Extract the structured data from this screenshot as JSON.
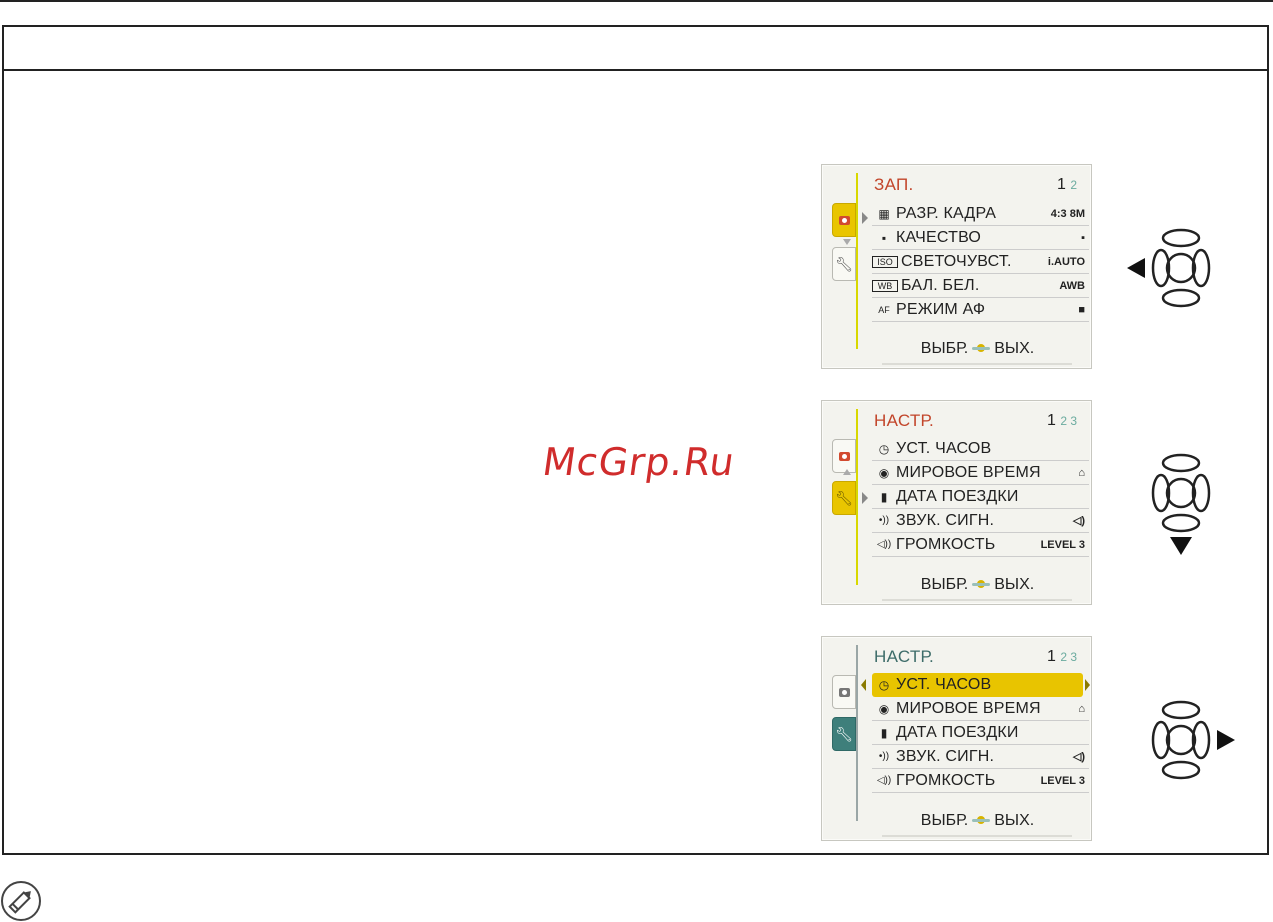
{
  "watermark": "McGrp.Ru",
  "screens": [
    {
      "title": "ЗАП.",
      "page_current": "1",
      "page_others": "2",
      "rows": [
        {
          "icon": "▦",
          "label": "РАЗР. КАДРА",
          "value": "4:3 8M"
        },
        {
          "icon": "▪",
          "label": "КАЧЕСТВО",
          "value": "▪"
        },
        {
          "icon": "ISO",
          "label": "СВЕТОЧУВСТ.",
          "value": "i.AUTO"
        },
        {
          "icon": "WB",
          "label": "БАЛ. БЕЛ.",
          "value": "AWB"
        },
        {
          "icon": "AF",
          "label": "РЕЖИМ АФ",
          "value": "■"
        }
      ],
      "footer_left": "ВЫБР.",
      "footer_right": "ВЫХ."
    },
    {
      "title": "НАСТР.",
      "page_current": "1",
      "page_others": "2 3",
      "rows": [
        {
          "icon": "◷",
          "label": "УСТ. ЧАСОВ",
          "value": ""
        },
        {
          "icon": "◉",
          "label": "МИРОВОЕ ВРЕМЯ",
          "value": "⌂"
        },
        {
          "icon": "▮",
          "label": "ДАТА ПОЕЗДКИ",
          "value": ""
        },
        {
          "icon": "•))",
          "label": "ЗВУК. СИГН.",
          "value": "◁)"
        },
        {
          "icon": "◁))",
          "label": "ГРОМКОСТЬ",
          "value": "LEVEL 3"
        }
      ],
      "footer_left": "ВЫБР.",
      "footer_right": "ВЫХ."
    },
    {
      "title": "НАСТР.",
      "page_current": "1",
      "page_others": "2 3",
      "rows": [
        {
          "icon": "◷",
          "label": "УСТ. ЧАСОВ",
          "value": ""
        },
        {
          "icon": "◉",
          "label": "МИРОВОЕ ВРЕМЯ",
          "value": "⌂"
        },
        {
          "icon": "▮",
          "label": "ДАТА ПОЕЗДКИ",
          "value": ""
        },
        {
          "icon": "•))",
          "label": "ЗВУК. СИГН.",
          "value": "◁)"
        },
        {
          "icon": "◁))",
          "label": "ГРОМКОСТЬ",
          "value": "LEVEL 3"
        }
      ],
      "footer_left": "ВЫБР.",
      "footer_right": "ВЫХ."
    }
  ],
  "dpads": [
    {
      "highlight": "left"
    },
    {
      "highlight": "down"
    },
    {
      "highlight": "right"
    }
  ],
  "note_icon": "pencil-icon"
}
